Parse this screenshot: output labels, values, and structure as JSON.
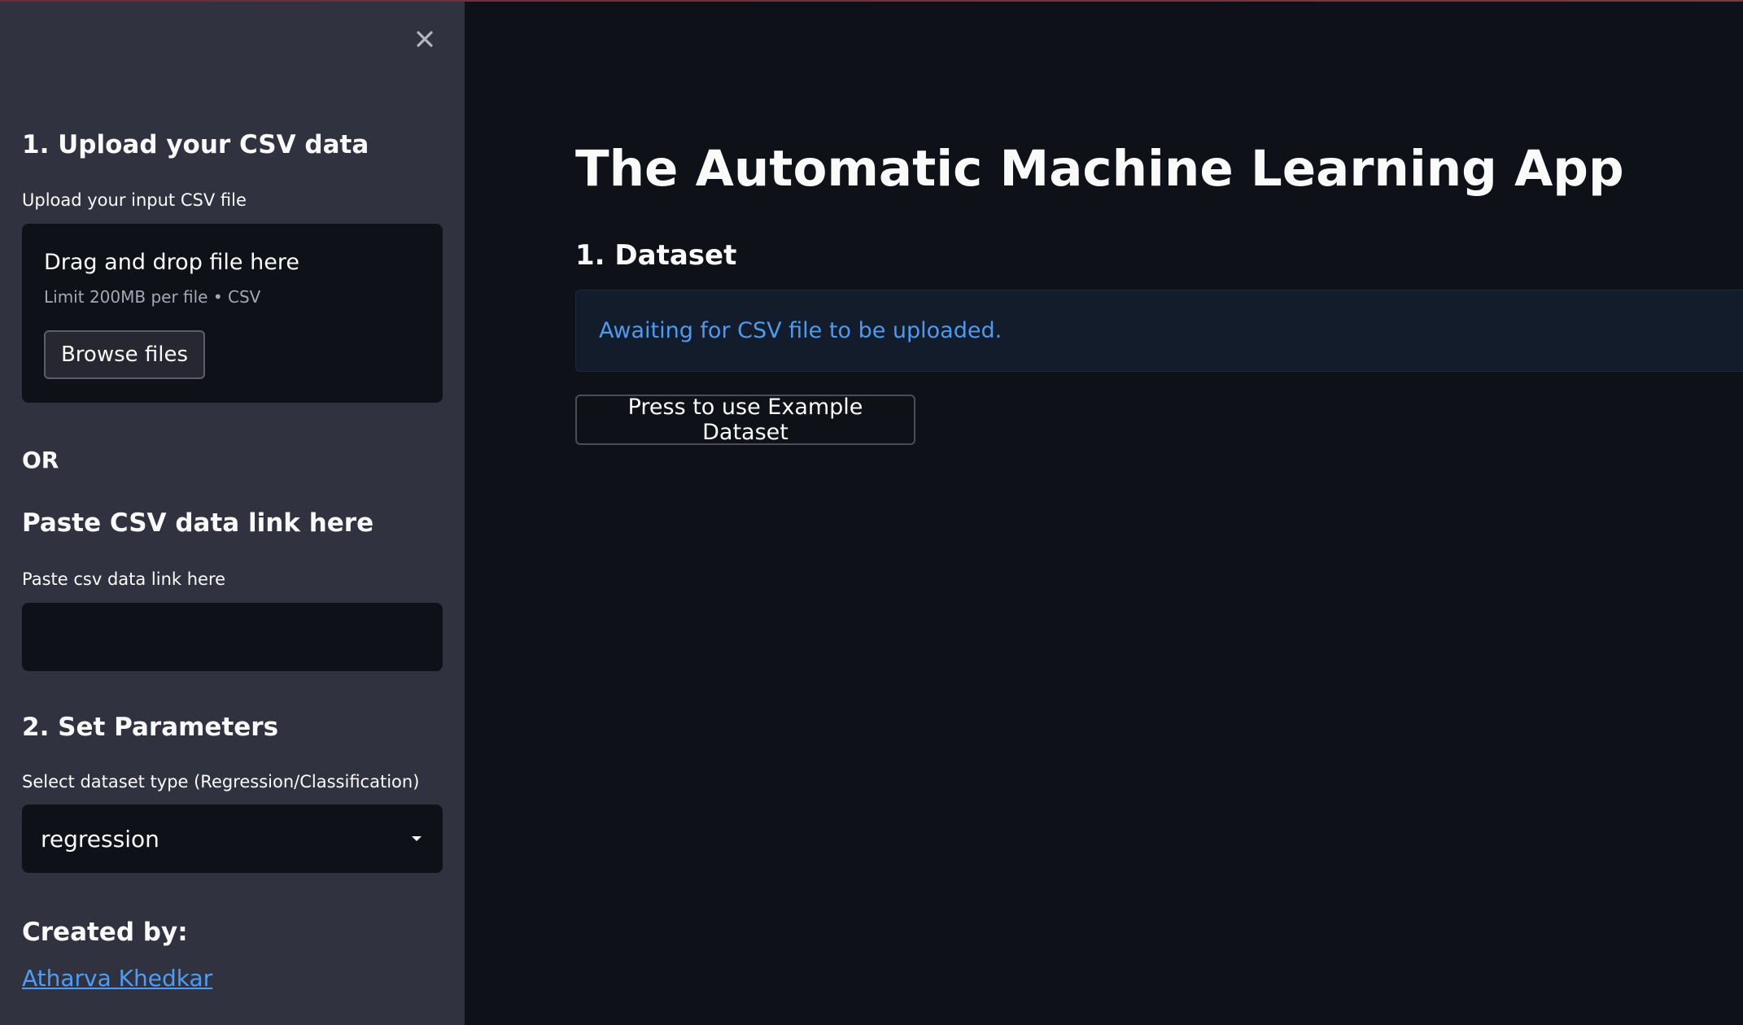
{
  "app": {
    "title": "The Automatic Machine Learning App"
  },
  "sidebar": {
    "close_icon": "close-icon",
    "upload_section": {
      "heading": "1. Upload your CSV data",
      "label": "Upload your input CSV file",
      "dropzone_title": "Drag and drop file here",
      "dropzone_limit": "Limit 200MB per file • CSV",
      "browse_label": "Browse files"
    },
    "or_text": "OR",
    "link_section": {
      "heading": "Paste CSV data link here",
      "label": "Paste csv data link here",
      "input_value": "",
      "input_placeholder": ""
    },
    "params_section": {
      "heading": "2. Set Parameters",
      "select_label": "Select dataset type (Regression/Classification)",
      "select_value": "regression",
      "select_icon": "chevron-down-icon"
    },
    "credits": {
      "heading": "Created by:",
      "author": "Atharva Khedkar"
    }
  },
  "main": {
    "dataset_heading": "1. Dataset",
    "info_message": "Awaiting for CSV file to be uploaded.",
    "example_button_label": "Press to use Example Dataset"
  },
  "colors": {
    "sidebar_bg": "#30333f",
    "main_bg": "#0e1117",
    "info_text": "#4b9bf0",
    "link": "#4d9cf5"
  }
}
